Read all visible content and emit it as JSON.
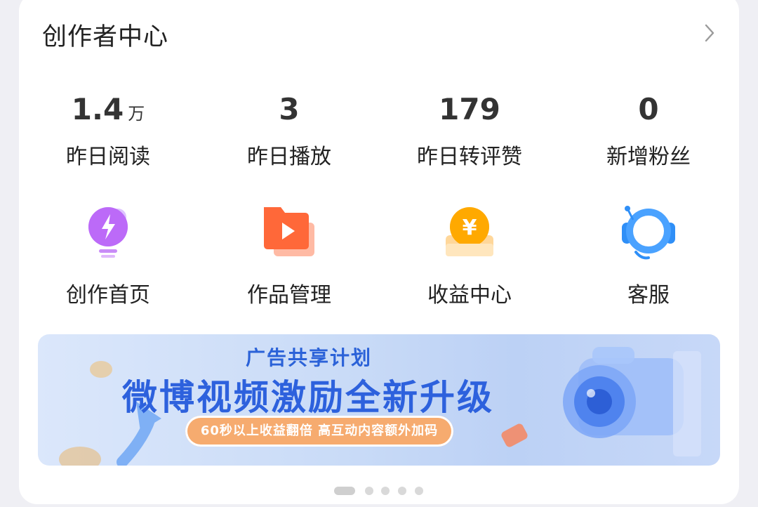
{
  "header": {
    "title": "创作者中心"
  },
  "stats": [
    {
      "value": "1.4",
      "unit": "万",
      "label": "昨日阅读"
    },
    {
      "value": "3",
      "unit": "",
      "label": "昨日播放"
    },
    {
      "value": "179",
      "unit": "",
      "label": "昨日转评赞"
    },
    {
      "value": "0",
      "unit": "",
      "label": "新增粉丝"
    }
  ],
  "tools": [
    {
      "label": "创作首页",
      "icon": "lightbulb-icon"
    },
    {
      "label": "作品管理",
      "icon": "video-folder-icon"
    },
    {
      "label": "收益中心",
      "icon": "yuan-coin-icon"
    },
    {
      "label": "客服",
      "icon": "headset-icon"
    }
  ],
  "banner": {
    "kicker": "广告共享计划",
    "headline": "微博视频激励全新升级",
    "pill": "60秒以上收益翻倍  高互动内容额外加码"
  },
  "pagination": {
    "total": 5,
    "active_index": 0
  },
  "colors": {
    "banner_blue": "#2d61dd",
    "pill_orange": "#f6ab6f"
  }
}
